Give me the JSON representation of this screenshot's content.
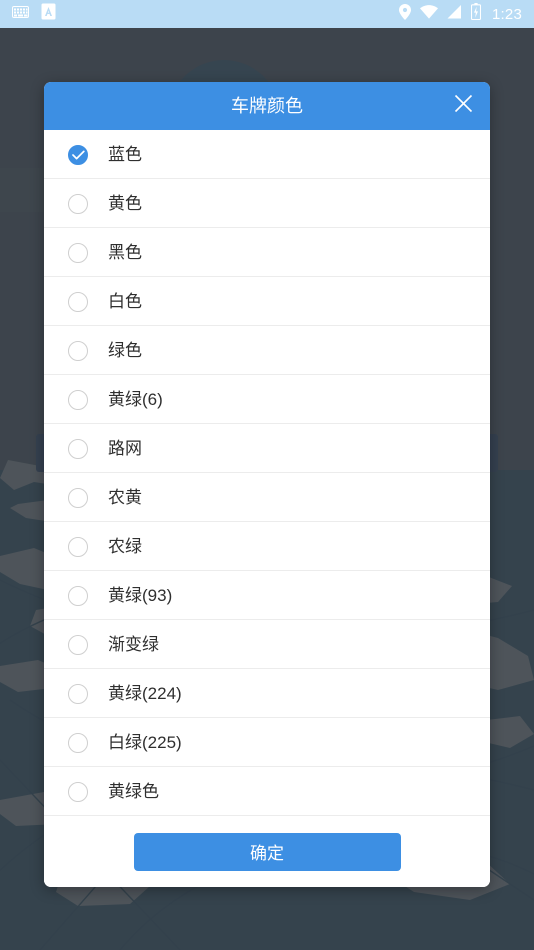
{
  "status_bar": {
    "background_color": "#b9dcf5",
    "time": "1:23",
    "left_icons": [
      "keyboard-icon",
      "input-method-badge-icon"
    ],
    "right_icons": [
      "location-pin-icon",
      "wifi-icon",
      "cellular-signal-icon",
      "battery-charging-icon"
    ]
  },
  "background_app": {
    "name": "map-view",
    "ocean_color": "#1d4055",
    "land_color": "#8c8f8d",
    "dim_color": "#3c444c",
    "blue_bar_color": "#1d3a5f"
  },
  "dialog": {
    "title": "车牌颜色",
    "header_color": "#3d8fe3",
    "close_icon_name": "close-icon",
    "accent_color": "#3d8fe3",
    "options": [
      {
        "label": "蓝色",
        "selected": true
      },
      {
        "label": "黄色",
        "selected": false
      },
      {
        "label": "黑色",
        "selected": false
      },
      {
        "label": "白色",
        "selected": false
      },
      {
        "label": "绿色",
        "selected": false
      },
      {
        "label": "黄绿(6)",
        "selected": false
      },
      {
        "label": "路网",
        "selected": false
      },
      {
        "label": "农黄",
        "selected": false
      },
      {
        "label": "农绿",
        "selected": false
      },
      {
        "label": "黄绿(93)",
        "selected": false
      },
      {
        "label": "渐变绿",
        "selected": false
      },
      {
        "label": "黄绿(224)",
        "selected": false
      },
      {
        "label": "白绿(225)",
        "selected": false
      },
      {
        "label": "黄绿色",
        "selected": false
      }
    ],
    "confirm_label": "确定"
  }
}
